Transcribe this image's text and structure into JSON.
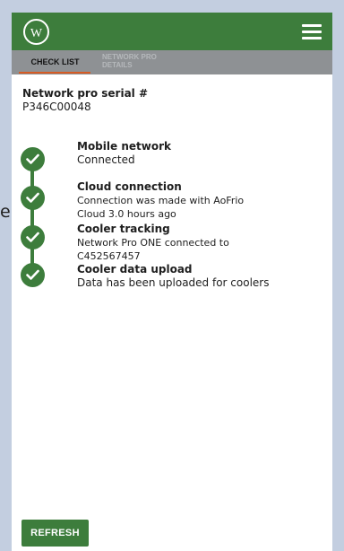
{
  "colors": {
    "outer_background": "#c3cee0",
    "brand_green": "#3d7d3c",
    "tab_bar": "#8e9194",
    "tab_active_underline": "#d65b24"
  },
  "stray_text": "e.",
  "appbar": {
    "logo_icon": "wilbur-logo-icon",
    "logo_text": "W",
    "menu_icon": "hamburger-menu-icon"
  },
  "tabs": [
    {
      "label": "CHECK LIST",
      "active": true
    },
    {
      "label": "NETWORK PRO DETAILS",
      "active": false
    }
  ],
  "serial": {
    "label": "Network pro serial #",
    "value": "P346C00048"
  },
  "checklist": [
    {
      "title": "Mobile network",
      "lines": [
        "Connected"
      ],
      "icon": "check-circle-icon"
    },
    {
      "title": "Cloud connection",
      "lines": [
        "Connection was made with AoFrio",
        "Cloud 3.0 hours ago"
      ],
      "icon": "check-circle-icon"
    },
    {
      "title": "Cooler tracking",
      "lines": [
        "Network Pro ONE connected to",
        "C452567457"
      ],
      "icon": "check-circle-icon"
    },
    {
      "title": "Cooler data upload",
      "lines": [
        "Data has been uploaded for coolers"
      ],
      "icon": "check-circle-icon"
    }
  ],
  "refresh_label": "REFRESH"
}
